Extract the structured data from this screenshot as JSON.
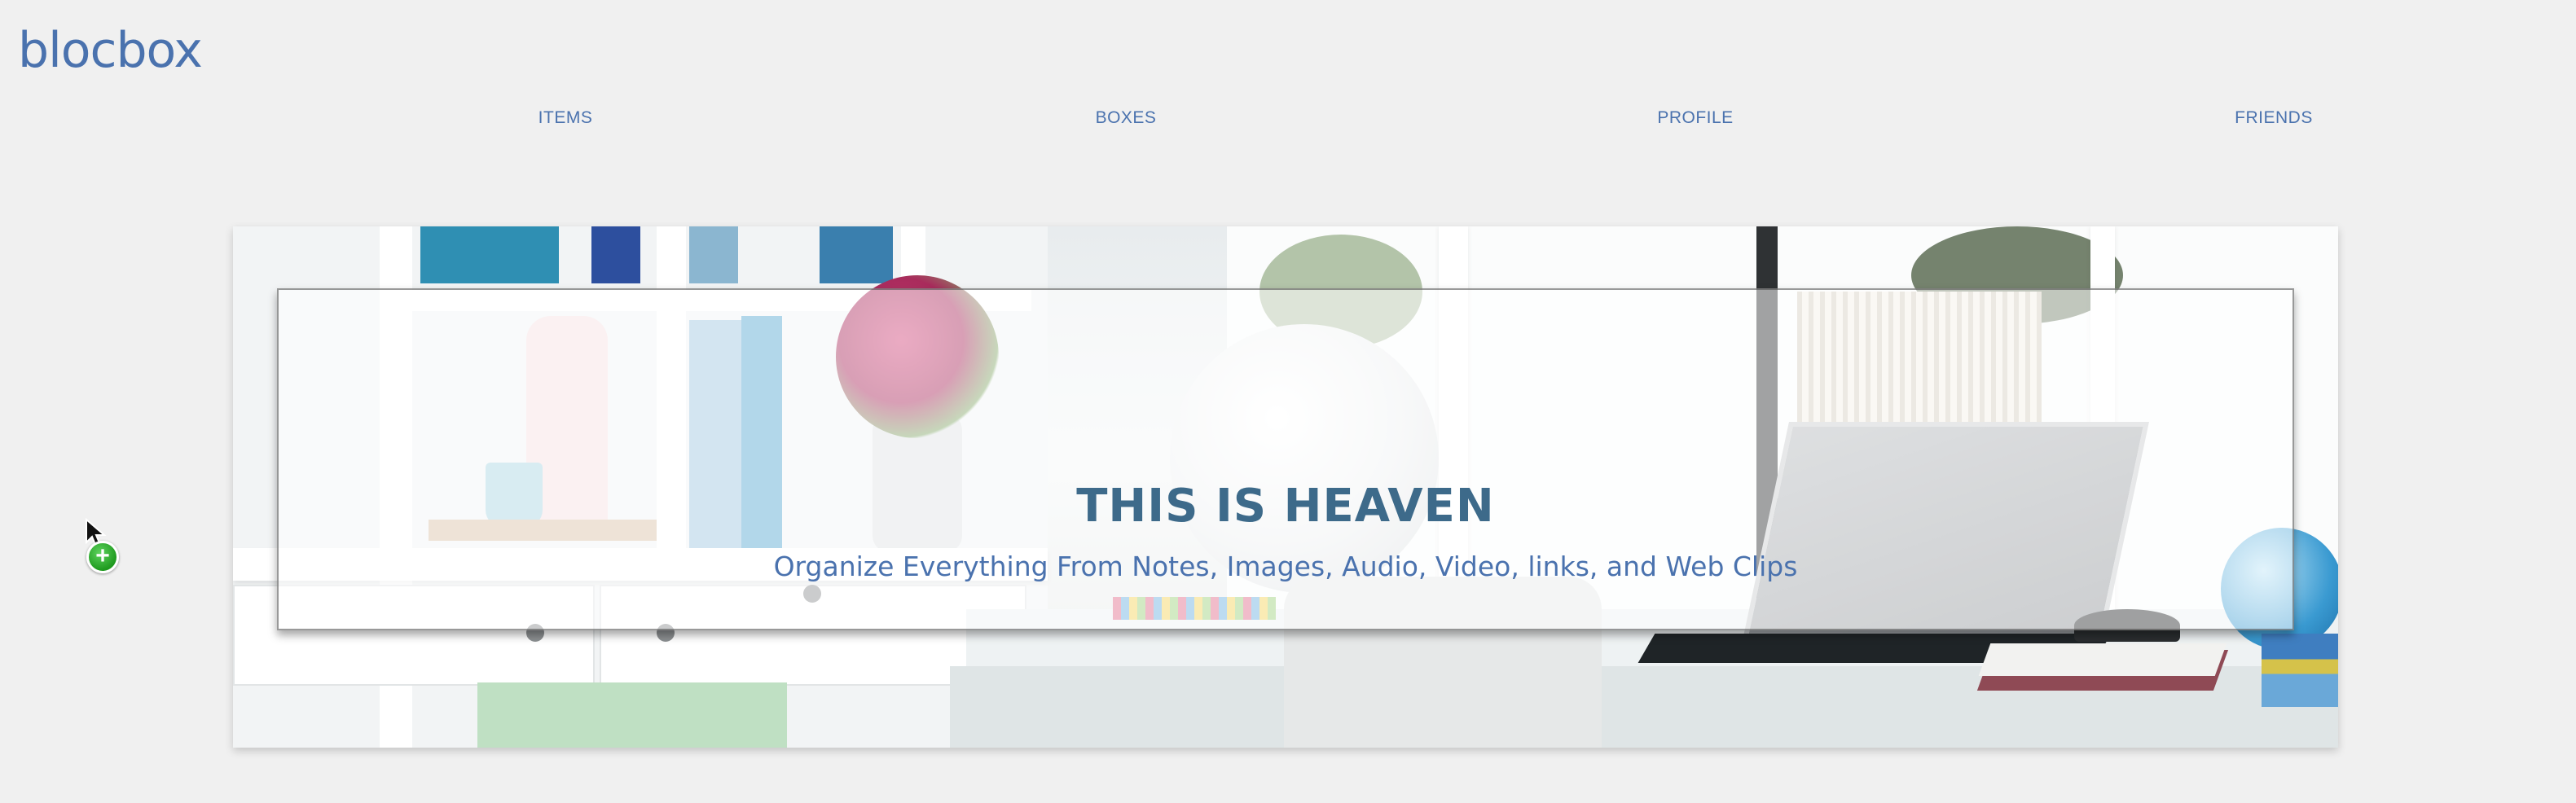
{
  "brand": {
    "logo_text": "blocbox",
    "color": "#4a72ae"
  },
  "nav": {
    "items": [
      {
        "label": "ITEMS"
      },
      {
        "label": "BOXES"
      },
      {
        "label": "PROFILE"
      },
      {
        "label": "FRIENDS"
      }
    ]
  },
  "hero": {
    "title": "THIS IS HEAVEN",
    "subtitle": "Organize Everything From Notes, Images, Audio, Video, links, and Web Clips",
    "title_color": "#3d6a8a",
    "subtitle_color": "#4a72ae",
    "image": "photo-collage-home-office"
  },
  "cursor": {
    "icon": "arrow-cursor-icon",
    "badge_icon": "add-plus-icon",
    "badge_symbol": "+",
    "badge_color": "#1f9a1f"
  },
  "colors": {
    "background": "#f0f0f0",
    "accent": "#4a72ae"
  }
}
